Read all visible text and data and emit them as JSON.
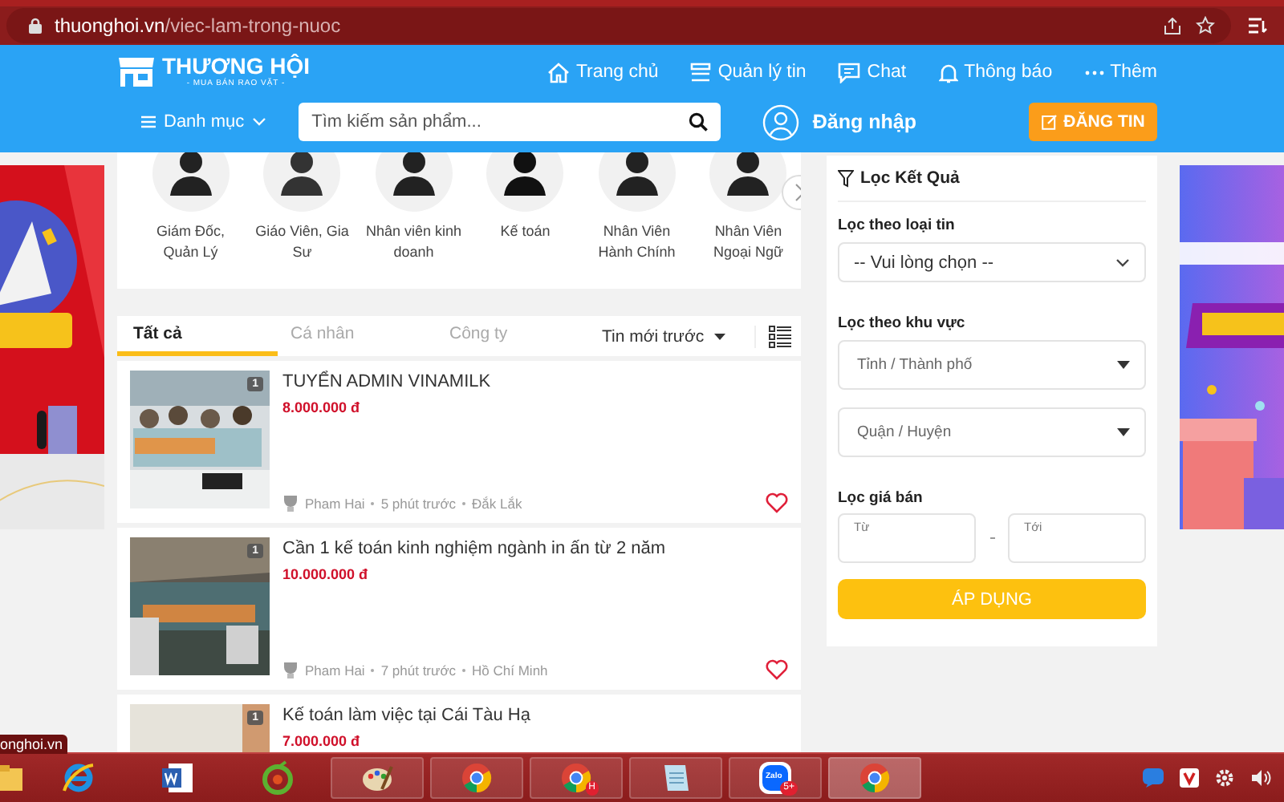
{
  "browser": {
    "url_host": "thuonghoi.vn",
    "url_path": "/viec-lam-trong-nuoc"
  },
  "header": {
    "logo_title": "THƯƠNG HỘI",
    "logo_tagline": "- MUA BÁN RAO VẶT -",
    "nav": [
      {
        "kind": "home",
        "label": "Trang chủ"
      },
      {
        "kind": "manage",
        "label": "Quản lý tin"
      },
      {
        "kind": "chat",
        "label": "Chat"
      },
      {
        "kind": "bell",
        "label": "Thông báo"
      },
      {
        "kind": "more",
        "label": "Thêm"
      }
    ],
    "category_menu": "Danh mục",
    "search_placeholder": "Tìm kiếm sản phẩm...",
    "login": "Đăng nhập",
    "post_button": "ĐĂNG TIN"
  },
  "categories": [
    {
      "label": "Giám Đốc, Quản Lý"
    },
    {
      "label": "Giáo Viên, Gia Sư"
    },
    {
      "label": "Nhân viên kinh doanh"
    },
    {
      "label": "Kế toán"
    },
    {
      "label": "Nhân Viên Hành Chính"
    },
    {
      "label": "Nhân Viên Ngoại Ngữ"
    }
  ],
  "tabs": [
    {
      "label": "Tất cả",
      "selected": true
    },
    {
      "label": "Cá nhân",
      "selected": false
    },
    {
      "label": "Công ty",
      "selected": false
    }
  ],
  "sort": "Tin mới trước",
  "listings": [
    {
      "title": "TUYỂN ADMIN VINAMILK",
      "price": "8.000.000 đ",
      "photo_count": "1",
      "author": "Pham Hai",
      "time": "5 phút trước",
      "location": "Đắk Lắk"
    },
    {
      "title": "Cần 1 kế toán kinh nghiệm ngành in ấn từ 2 năm",
      "price": "10.000.000 đ",
      "photo_count": "1",
      "author": "Pham Hai",
      "time": "7 phút trước",
      "location": "Hồ Chí Minh"
    },
    {
      "title": "Kế toán làm việc tại Cái Tàu Hạ",
      "price": "7.000.000 đ",
      "photo_count": "1"
    }
  ],
  "filter": {
    "title": "Lọc Kết Quả",
    "type_label": "Lọc theo loại tin",
    "type_value": "-- Vui lòng chọn --",
    "area_label": "Lọc theo khu vực",
    "province_placeholder": "Tỉnh / Thành phố",
    "district_placeholder": "Quận / Huyện",
    "price_label": "Lọc giá bán",
    "from_placeholder": "Từ",
    "to_placeholder": "Tới",
    "apply": "ÁP DỤNG"
  },
  "status_url": "onghoi.vn",
  "taskbar": [
    {
      "kind": "folder"
    },
    {
      "kind": "ie"
    },
    {
      "kind": "word"
    },
    {
      "kind": "coccoc"
    },
    {
      "kind": "paint"
    },
    {
      "kind": "chrome"
    },
    {
      "kind": "chrome",
      "badge": "H"
    },
    {
      "kind": "notepad"
    },
    {
      "kind": "zalo",
      "label": "Zalo",
      "badge": "5+"
    },
    {
      "kind": "chrome",
      "active": true
    }
  ]
}
